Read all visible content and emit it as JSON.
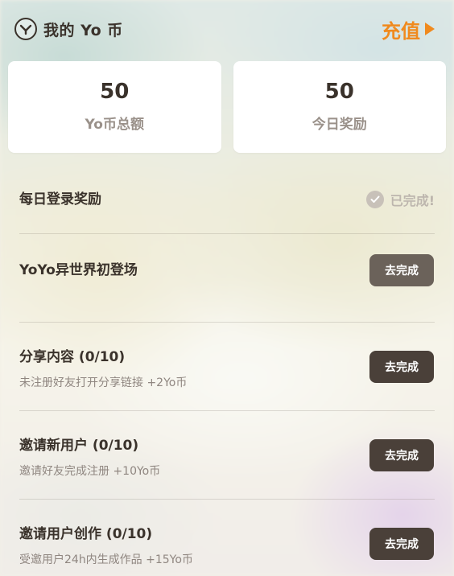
{
  "header": {
    "title": "我的 Yo 币",
    "recharge_label": "充值"
  },
  "summary": [
    {
      "value": "50",
      "label": "Yo币总额"
    },
    {
      "value": "50",
      "label": "今日奖励"
    }
  ],
  "tasks": [
    {
      "title": "每日登录奖励",
      "status_label": "已完成!"
    },
    {
      "title": "YoYo异世界初登场",
      "button_label": "去完成"
    },
    {
      "title": "分享内容 (0/10)",
      "desc": "未注册好友打开分享链接 +2Yo币",
      "button_label": "去完成"
    },
    {
      "title": "邀请新用户 (0/10)",
      "desc": "邀请好友完成注册 +10Yo币",
      "button_label": "去完成"
    },
    {
      "title": "邀请用户创作 (0/10)",
      "desc": "受邀用户24h内生成作品 +15Yo币",
      "button_label": "去完成"
    }
  ],
  "colors": {
    "accent": "#f08a1e",
    "button": "#4a4039",
    "text": "#3a322b"
  }
}
